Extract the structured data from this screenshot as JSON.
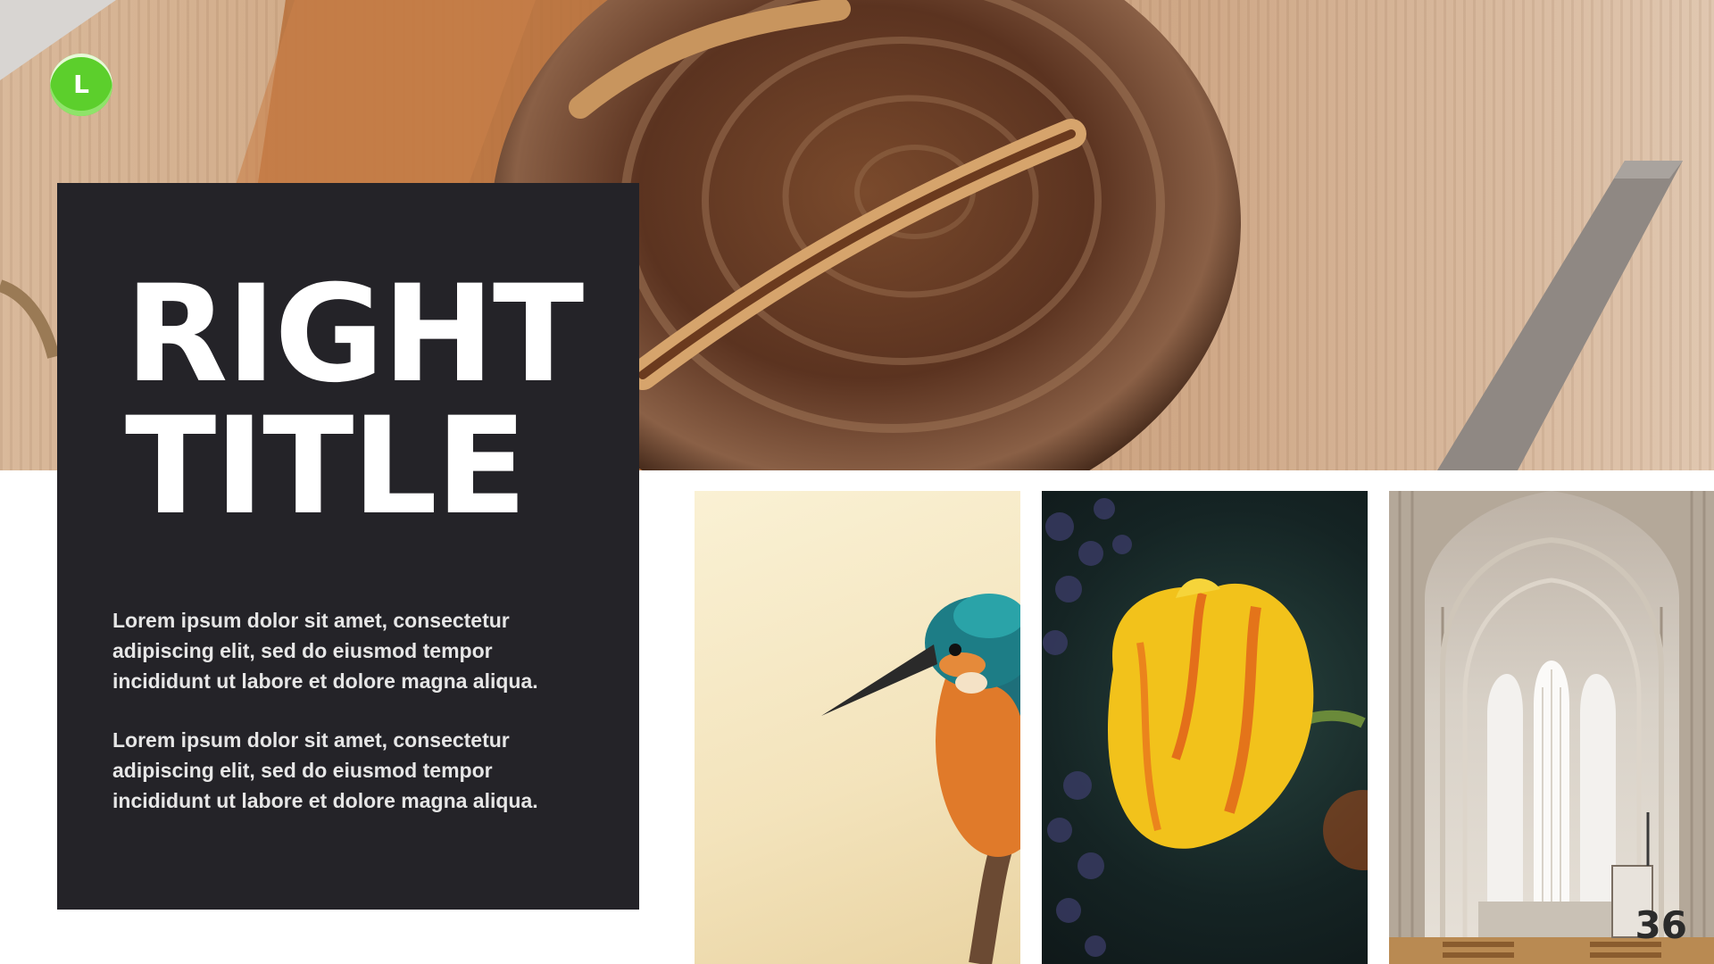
{
  "logo": {
    "letter": "L",
    "color": "#5ccf2c"
  },
  "panel": {
    "title_line1": "RIGHT",
    "title_line2": "TITLE",
    "paragraph1": "Lorem ipsum dolor sit amet, consectetur adipiscing elit, sed do eiusmod tempor incididunt ut labore et dolore magna aliqua.",
    "paragraph2": "Lorem ipsum dolor sit amet, consectetur adipiscing elit, sed do eiusmod tempor incididunt ut labore et dolore magna aliqua.",
    "background": "#242328"
  },
  "images": {
    "hero": "bread-loaf-on-cutting-board-photo",
    "tiles": [
      "kingfisher-bird-photo",
      "yellow-tulip-photo",
      "church-interior-arches-photo"
    ]
  },
  "slide_number": "36"
}
